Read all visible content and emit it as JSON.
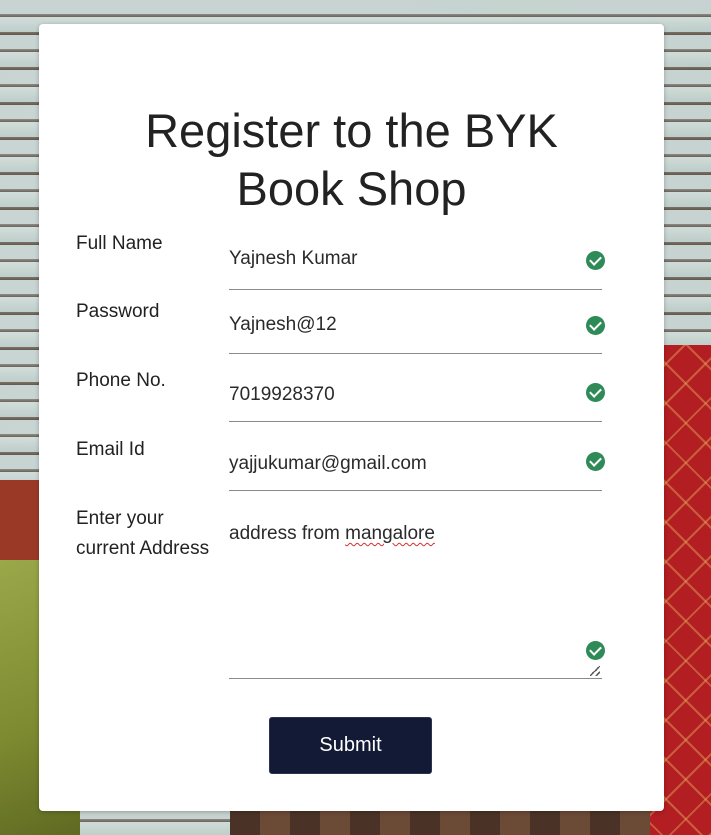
{
  "form": {
    "title_line1": "Register to the BYK",
    "title_line2": "Book Shop",
    "fields": [
      {
        "label": "Full Name",
        "value": "Yajnesh Kumar"
      },
      {
        "label": "Password",
        "value": "Yajnesh@12"
      },
      {
        "label": "Phone No.",
        "value": "7019928370"
      },
      {
        "label": "Email Id",
        "value": "yajjukumar@gmail.com"
      }
    ],
    "address": {
      "label_line1": "Enter your",
      "label_line2": "current Address",
      "value_prefix": "address from ",
      "value_misspelled": "mangalore"
    },
    "submit_label": "Submit"
  },
  "colors": {
    "valid_check": "#2e8b57",
    "submit_bg": "#121a35",
    "spellcheck_underline": "#d0312d"
  },
  "icons": {
    "valid": "check-circle-icon",
    "resize": "resize-handle-icon"
  }
}
